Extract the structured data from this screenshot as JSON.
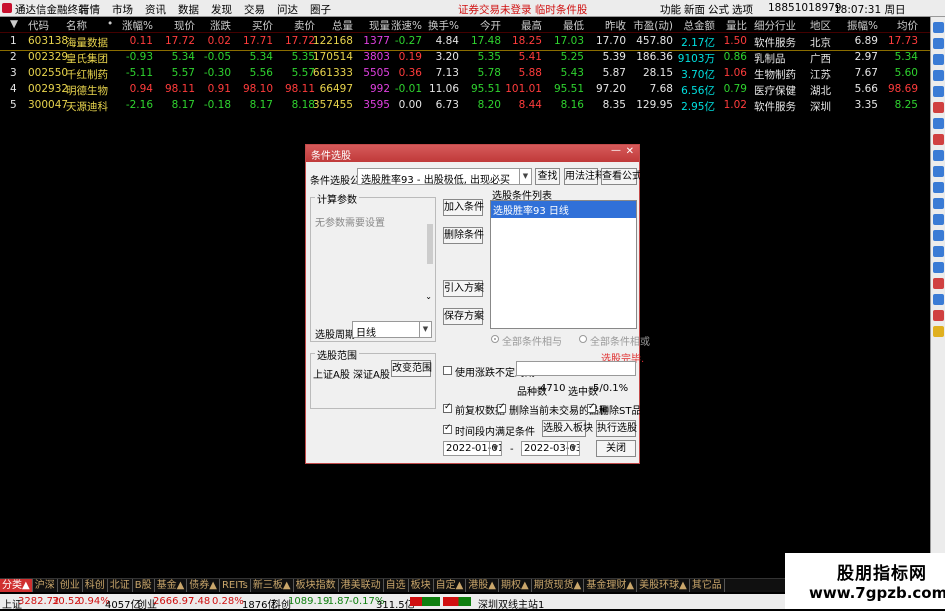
{
  "app": {
    "title": "通达信金融终端"
  },
  "menu": [
    "行情",
    "市场",
    "资讯",
    "数据",
    "发现",
    "交易",
    "问达",
    "圈子"
  ],
  "notice": "证券交易未登录 临时条件股",
  "top_right": {
    "items": [
      "功能",
      "新面",
      "公式",
      "选项"
    ],
    "phone": "18851018979",
    "time": "18:07:31 周日"
  },
  "table": {
    "headers": [
      "代码",
      "名称",
      "•",
      "涨幅%",
      "现价",
      "涨跌",
      "买价",
      "卖价",
      "总量",
      "现量",
      "涨速%",
      "换手%",
      "今开",
      "最高",
      "最低",
      "昨收",
      "市盈(动)",
      "总金额",
      "量比",
      "细分行业",
      "地区",
      "振幅%",
      "均价"
    ],
    "rows": [
      {
        "idx": "1",
        "code": "603138",
        "name": "海量数据",
        "chg": "0.11",
        "price": "17.72",
        "diff": "0.02",
        "bid": "17.71",
        "ask": "17.72",
        "vol": "122168",
        "cur": "1377",
        "speed": "-0.27",
        "turn": "4.84",
        "open": "17.48",
        "high": "18.25",
        "low": "17.03",
        "prev": "17.70",
        "pe": "457.80",
        "amt": "2.17亿",
        "ratio": "1.50",
        "ind": "软件服务",
        "area": "北京",
        "amp": "6.89",
        "avg": "17.73"
      },
      {
        "idx": "2",
        "code": "002329",
        "name": "皇氏集团",
        "chg": "-0.93",
        "price": "5.34",
        "diff": "-0.05",
        "bid": "5.34",
        "ask": "5.35",
        "vol": "170514",
        "cur": "3803",
        "speed": "0.19",
        "turn": "3.20",
        "open": "5.35",
        "high": "5.41",
        "low": "5.25",
        "prev": "5.39",
        "pe": "186.36",
        "amt": "9103万",
        "ratio": "0.86",
        "ind": "乳制品",
        "area": "广西",
        "amp": "2.97",
        "avg": "5.34"
      },
      {
        "idx": "3",
        "code": "002550",
        "name": "千红制药",
        "chg": "-5.11",
        "price": "5.57",
        "diff": "-0.30",
        "bid": "5.56",
        "ask": "5.57",
        "vol": "661333",
        "cur": "5505",
        "speed": "0.36",
        "turn": "7.13",
        "open": "5.78",
        "high": "5.88",
        "low": "5.43",
        "prev": "5.87",
        "pe": "28.15",
        "amt": "3.70亿",
        "ratio": "1.06",
        "ind": "生物制药",
        "area": "江苏",
        "amp": "7.67",
        "avg": "5.60"
      },
      {
        "idx": "4",
        "code": "002932",
        "name": "明德生物",
        "chg": "0.94",
        "price": "98.11",
        "diff": "0.91",
        "bid": "98.10",
        "ask": "98.11",
        "vol": "66497",
        "cur": "992",
        "speed": "-0.01",
        "turn": "11.06",
        "open": "95.51",
        "high": "101.01",
        "low": "95.51",
        "prev": "97.20",
        "pe": "7.68",
        "amt": "6.56亿",
        "ratio": "0.79",
        "ind": "医疗保健",
        "area": "湖北",
        "amp": "5.66",
        "avg": "98.69"
      },
      {
        "idx": "5",
        "code": "300047",
        "name": "天源迪科",
        "chg": "-2.16",
        "price": "8.17",
        "diff": "-0.18",
        "bid": "8.17",
        "ask": "8.18",
        "vol": "357455",
        "cur": "3595",
        "speed": "0.00",
        "turn": "6.73",
        "open": "8.20",
        "high": "8.44",
        "low": "8.16",
        "prev": "8.35",
        "pe": "129.95",
        "amt": "2.95亿",
        "ratio": "1.02",
        "ind": "软件服务",
        "area": "深圳",
        "amp": "3.35",
        "avg": "8.25"
      }
    ]
  },
  "dialog": {
    "title": "条件选股",
    "formula_label": "条件选股公式",
    "formula_value": "选股胜率93 - 出股极低, 出现必买",
    "btn_find": "查找",
    "btn_usage": "用法注释",
    "btn_view": "查看公式",
    "params_title": "计算参数",
    "params_empty": "无参数需要设置",
    "period_label": "选股周期:",
    "period_value": "日线",
    "btn_add": "加入条件",
    "btn_del": "删除条件",
    "btn_import": "引入方案",
    "btn_save": "保存方案",
    "list_title": "选股条件列表",
    "list_items": [
      "选股胜率93 日线"
    ],
    "radio_and": "全部条件相与",
    "radio_or": "全部条件相或",
    "done": "选股完毕.",
    "range_title": "选股范围",
    "range_value": "上证A股 深证A股",
    "btn_range": "改变范围",
    "chk_uncertain": "使用涨跌不定周期",
    "stock_count_label": "品种数",
    "stock_count": "4710",
    "selected_label": "选中数",
    "selected": "5/0.1%",
    "chk_fq": "前复权数据",
    "chk_notrade": "删除当前未交易的品种",
    "chk_st": "删除ST品种",
    "chk_range": "时间段内满足条件",
    "btn_block": "选股入板块",
    "btn_run": "执行选股",
    "date_from": "2022-01-01",
    "date_to": "2022-03-03",
    "date_sep": "-",
    "btn_close": "关闭"
  },
  "tabs": [
    "分类▲",
    "沪深",
    "创业",
    "科创",
    "北证",
    "B股",
    "基金▲",
    "债券▲",
    "REITs",
    "新三板▲",
    "板块指数",
    "港美联动",
    "自选",
    "板块",
    "自定▲",
    "港股▲",
    "期权▲",
    "期货现货▲",
    "基金理财▲",
    "美股环球▲",
    "其它品"
  ],
  "status": {
    "sh_label": "上证",
    "sh": "3282.72",
    "sh_chg": "30.52",
    "sh_pct": "0.94%",
    "sh_amt": "4057亿",
    "cy_label": "创业",
    "cy": "2666.97",
    "cy_chg": "7.48",
    "cy_pct": "0.28%",
    "cy_amt": "1876亿",
    "kc_label": "科创",
    "kc": "1089.19",
    "kc_chg": "-1.87",
    "kc_pct": "-0.17%",
    "kc_amt": "311.5亿",
    "server": "深圳双线主站1"
  },
  "watermark": {
    "line1": "股朋指标网",
    "line2": "www.7gpzb.com"
  },
  "colors": {
    "up": "#ff3c3c",
    "down": "#2fd32f",
    "accent": "#c03a3a"
  }
}
